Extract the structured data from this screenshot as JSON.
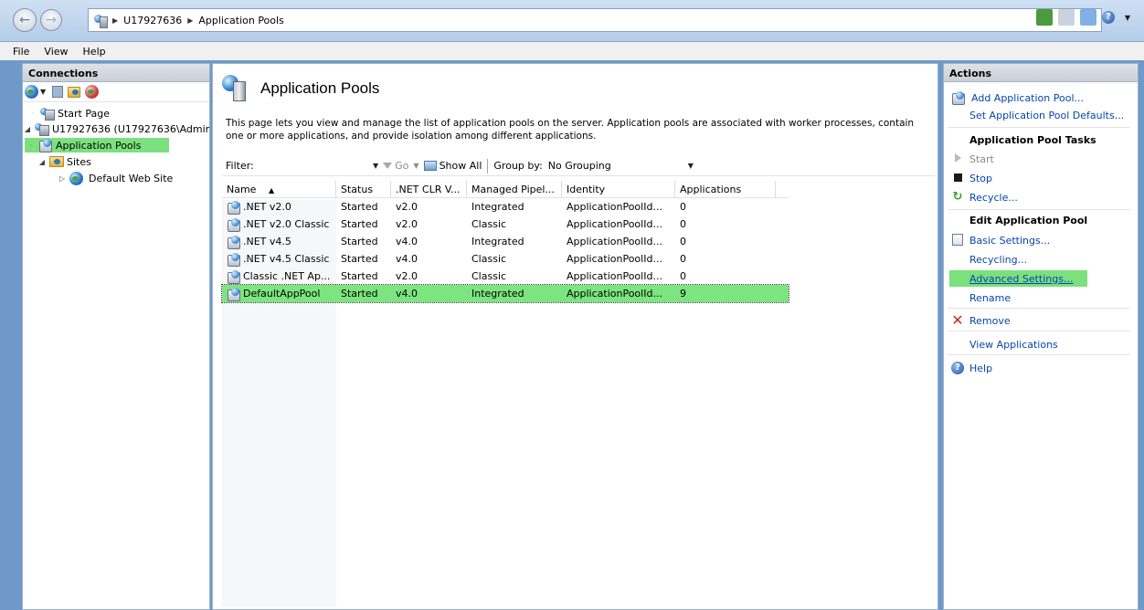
{
  "address": {
    "segments": [
      "U17927636",
      "Application Pools"
    ]
  },
  "menu": [
    "File",
    "View",
    "Help"
  ],
  "connections": {
    "title": "Connections",
    "tree": {
      "start_page": "Start Page",
      "server": "U17927636 (U17927636\\Admir",
      "app_pools": "Application Pools",
      "sites": "Sites",
      "default_site": "Default Web Site"
    }
  },
  "main": {
    "title": "Application Pools",
    "description": "This page lets you view and manage the list of application pools on the server. Application pools are associated with worker processes, contain one or more applications, and provide isolation among different applications.",
    "filter": {
      "label": "Filter:",
      "go": "Go",
      "show_all": "Show All",
      "group_by_label": "Group by:",
      "group_by_value": "No Grouping"
    },
    "columns": [
      "Name",
      "Status",
      ".NET CLR V...",
      "Managed Pipel...",
      "Identity",
      "Applications"
    ],
    "rows": [
      {
        "name": ".NET v2.0",
        "status": "Started",
        "clr": "v2.0",
        "pipeline": "Integrated",
        "identity": "ApplicationPoolId...",
        "apps": "0"
      },
      {
        "name": ".NET v2.0 Classic",
        "status": "Started",
        "clr": "v2.0",
        "pipeline": "Classic",
        "identity": "ApplicationPoolId...",
        "apps": "0"
      },
      {
        "name": ".NET v4.5",
        "status": "Started",
        "clr": "v4.0",
        "pipeline": "Integrated",
        "identity": "ApplicationPoolId...",
        "apps": "0"
      },
      {
        "name": ".NET v4.5 Classic",
        "status": "Started",
        "clr": "v4.0",
        "pipeline": "Classic",
        "identity": "ApplicationPoolId...",
        "apps": "0"
      },
      {
        "name": "Classic .NET Ap...",
        "status": "Started",
        "clr": "v2.0",
        "pipeline": "Classic",
        "identity": "ApplicationPoolId...",
        "apps": "0"
      },
      {
        "name": "DefaultAppPool",
        "status": "Started",
        "clr": "v4.0",
        "pipeline": "Integrated",
        "identity": "ApplicationPoolId...",
        "apps": "9"
      }
    ]
  },
  "actions": {
    "title": "Actions",
    "add_pool": "Add Application Pool...",
    "set_defaults": "Set Application Pool Defaults...",
    "tasks_head": "Application Pool Tasks",
    "start": "Start",
    "stop": "Stop",
    "recycle": "Recycle...",
    "edit_head": "Edit Application Pool",
    "basic_settings": "Basic Settings...",
    "recycling": "Recycling...",
    "advanced_settings": "Advanced Settings...",
    "rename": "Rename",
    "remove": "Remove",
    "view_apps": "View Applications",
    "help": "Help"
  },
  "colors": {
    "highlight": "#7be07d",
    "link": "#0645ad"
  }
}
